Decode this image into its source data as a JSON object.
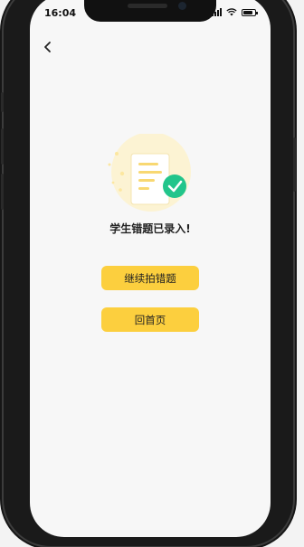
{
  "status": {
    "time": "16:04"
  },
  "icons": {
    "back": "chevron-left-icon",
    "illustration": "document-check-icon"
  },
  "message": "学生错题已录入!",
  "buttons": {
    "continue": "继续拍错题",
    "home": "回首页"
  },
  "colors": {
    "button": "#fccf3e",
    "check_badge": "#22c58b",
    "background": "#f7f7f7"
  }
}
